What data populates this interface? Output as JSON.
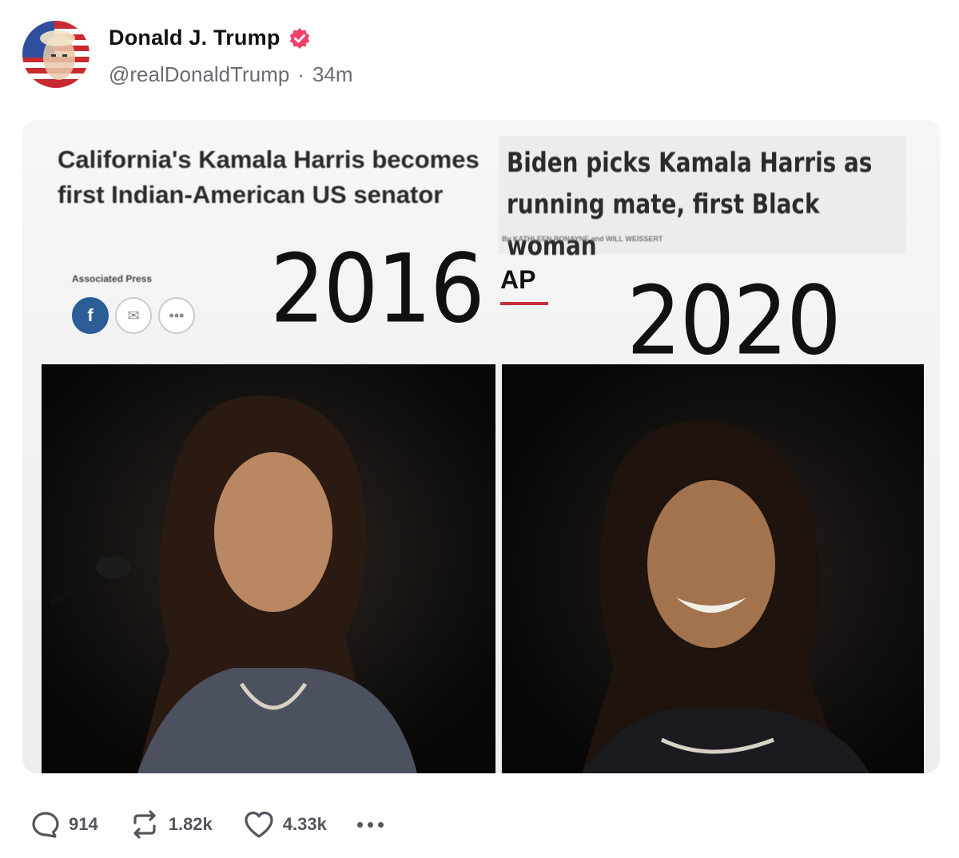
{
  "post": {
    "display_name": "Donald J. Trump",
    "handle": "@realDonaldTrump",
    "separator": "·",
    "time": "34m",
    "verified_icon": "verified-badge-icon",
    "verified_color": "#f2406b"
  },
  "image": {
    "left_headline": "California's Kamala Harris becomes first Indian-American US senator",
    "right_headline": "Biden picks Kamala Harris as running mate, first Black woman",
    "left_source": "Associated Press",
    "right_byline": "By KATHLEEN RONAYNE and WILL WEISSERT",
    "ap_logo": "AP",
    "year_left": "2016",
    "year_right": "2020",
    "share_facebook": "f"
  },
  "actions": {
    "replies": "914",
    "reposts": "1.82k",
    "likes": "4.33k",
    "reply_icon": "reply-icon",
    "repost_icon": "repost-icon",
    "like_icon": "heart-icon",
    "more_icon": "more-icon"
  },
  "colors": {
    "text_primary": "#111111",
    "text_secondary": "#6b6b73",
    "action_gray": "#55555e",
    "ap_red": "#c9303a"
  }
}
